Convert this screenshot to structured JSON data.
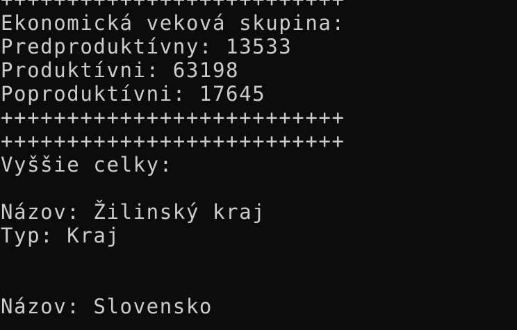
{
  "theme": {
    "background": "#0c0c0c",
    "foreground": "#cccccc"
  },
  "console": {
    "lines": [
      "++++++++++++++++++++++++++",
      "Ekonomická veková skupina:",
      "Predproduktívny: 13533",
      "Produktívni: 63198",
      "Poproduktívni: 17645",
      "++++++++++++++++++++++++++",
      "++++++++++++++++++++++++++",
      "Vyššie celky:",
      "",
      "Názov: Žilinský kraj",
      "Typ: Kraj",
      "",
      "",
      "Názov: Slovensko"
    ]
  }
}
